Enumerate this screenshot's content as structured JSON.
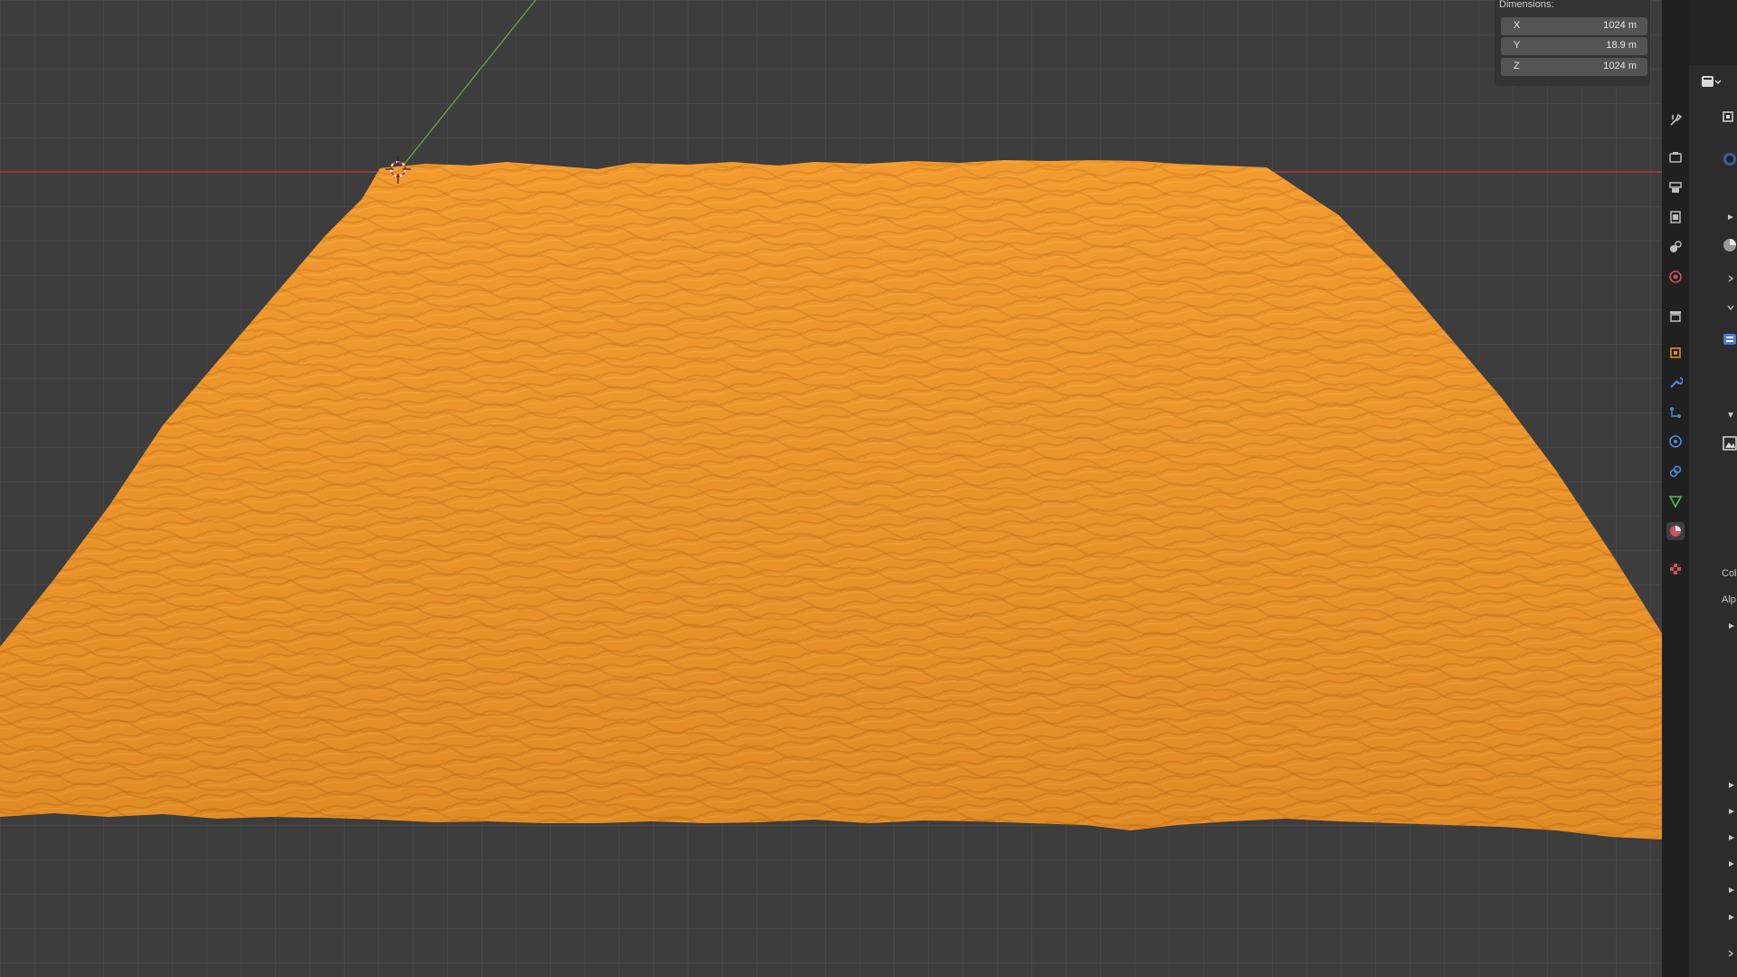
{
  "dimensions_panel": {
    "header": "Dimensions:",
    "fields": [
      {
        "axis": "X",
        "value": "1024 m"
      },
      {
        "axis": "Y",
        "value": "18.9 m"
      },
      {
        "axis": "Z",
        "value": "1024 m"
      }
    ]
  },
  "properties_tabs": [
    {
      "icon": "tool-icon",
      "color": "#bdbdbd"
    },
    {
      "icon": "render-icon",
      "color": "#bdbdbd"
    },
    {
      "icon": "output-icon",
      "color": "#bdbdbd"
    },
    {
      "icon": "view-layer-icon",
      "color": "#bdbdbd"
    },
    {
      "icon": "scene-icon",
      "color": "#bdbdbd"
    },
    {
      "icon": "world-icon",
      "color": "#d05060"
    },
    {
      "icon": "collection-icon",
      "color": "#bdbdbd"
    },
    {
      "icon": "object-icon",
      "color": "#e08a2a"
    },
    {
      "icon": "modifier-icon",
      "color": "#4a8ae0"
    },
    {
      "icon": "particles-icon",
      "color": "#4a8ae0"
    },
    {
      "icon": "physics-icon",
      "color": "#4a8ae0"
    },
    {
      "icon": "constraints-icon",
      "color": "#4a8ae0"
    },
    {
      "icon": "data-icon",
      "color": "#4ac060"
    },
    {
      "icon": "material-icon",
      "color": "#d05060"
    },
    {
      "icon": "texture-icon",
      "color": "#d05060"
    }
  ],
  "properties_panel": {
    "labels": [
      "Col",
      "Alp"
    ]
  },
  "colors": {
    "terrain": "#f0962a",
    "x_axis": "#c0393b",
    "y_axis": "#6da83a",
    "viewport_bg": "#3d3d3d"
  }
}
